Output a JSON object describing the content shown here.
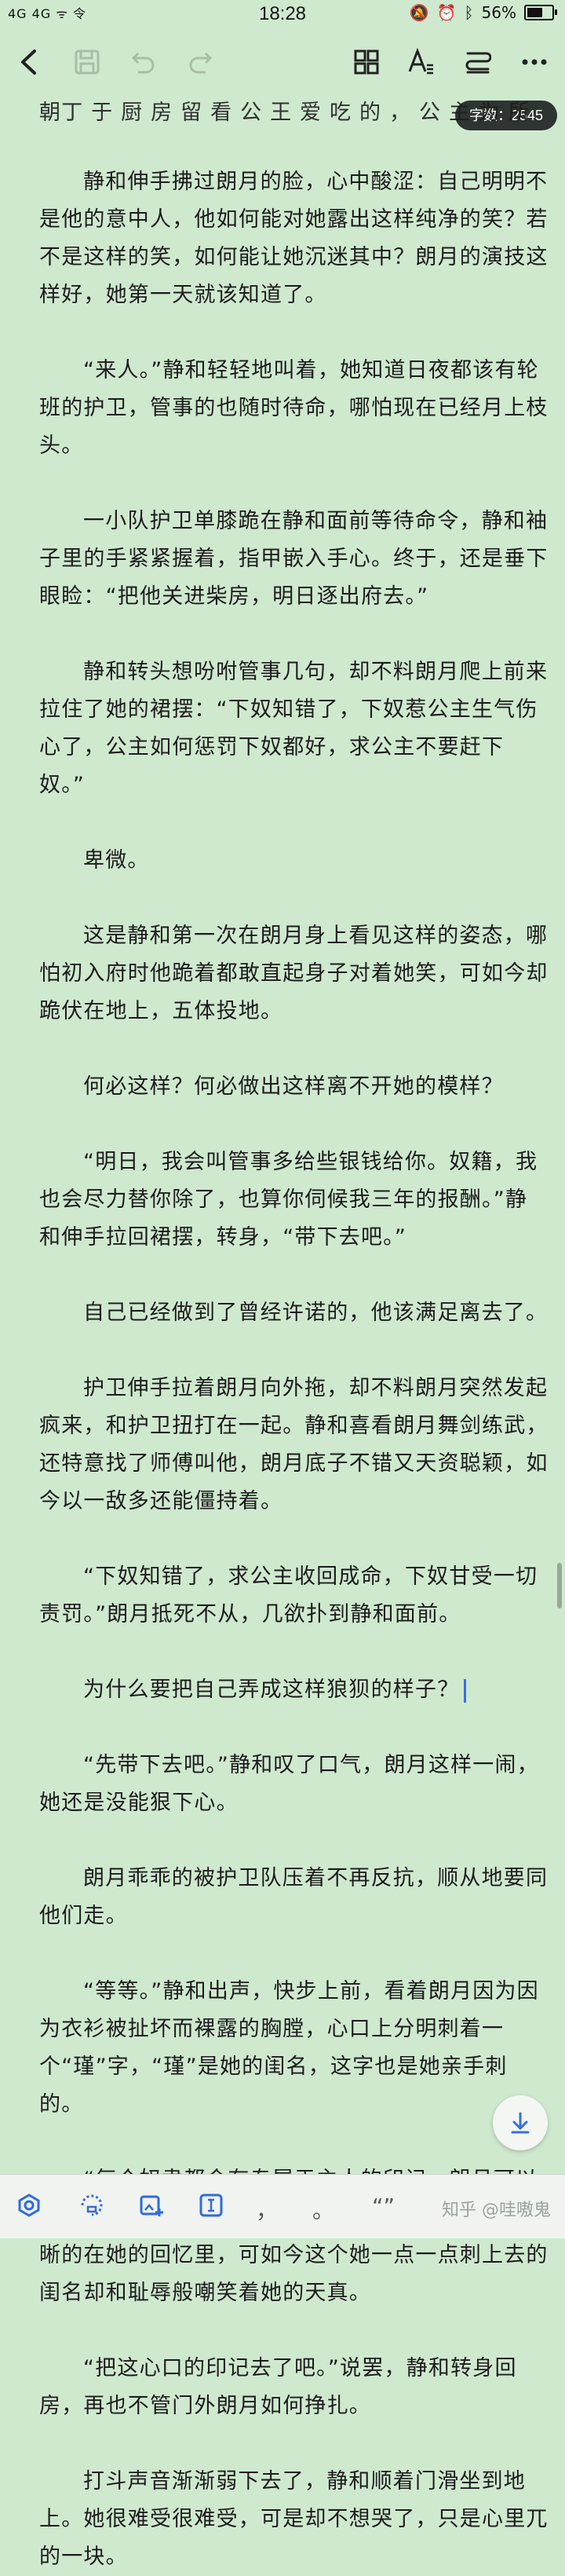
{
  "status": {
    "signal": "4G 4G ᯤ 令",
    "time": "18:28",
    "icons": [
      "bell-icon",
      "alarm-icon",
      "bluetooth-icon",
      "wifi-icon"
    ],
    "battery": "56%"
  },
  "toolbar": {
    "icons": [
      "back-icon",
      "save-icon",
      "undo-icon",
      "redo-icon",
      "layout-icon",
      "font-icon",
      "format-icon",
      "more-icon"
    ],
    "word_count": "字数：2545"
  },
  "paragraphs": [
    "朝丁 于 厨 房 留 看 公 王 爱 吃 的 ， 公 主 为 所 然 的 ？",
    "静和伸手拂过朗月的脸，心中酸涩：自己明明不是他的意中人，他如何能对她露出这样纯净的笑？若不是这样的笑，如何能让她沉迷其中？朗月的演技这样好，她第一天就该知道了。",
    "“来人。”静和轻轻地叫着，她知道日夜都该有轮班的护卫，管事的也随时待命，哪怕现在已经月上枝头。",
    "一小队护卫单膝跪在静和面前等待命令，静和袖子里的手紧紧握着，指甲嵌入手心。终于，还是垂下眼睑：“把他关进柴房，明日逐出府去。”",
    "静和转头想吩咐管事几句，却不料朗月爬上前来拉住了她的裙摆：“下奴知错了，下奴惹公主生气伤心了，公主如何惩罚下奴都好，求公主不要赶下奴。”",
    "卑微。",
    "这是静和第一次在朗月身上看见这样的姿态，哪怕初入府时他跪着都敢直起身子对着她笑，可如今却跪伏在地上，五体投地。",
    "何必这样？何必做出这样离不开她的模样？",
    "“明日，我会叫管事多给些银钱给你。奴籍，我也会尽力替你除了，也算你伺候我三年的报酬。”静和伸手拉回裙摆，转身，“带下去吧。”",
    "自己已经做到了曾经许诺的，他该满足离去了。",
    "护卫伸手拉着朗月向外拖，却不料朗月突然发起疯来，和护卫扭打在一起。静和喜看朗月舞剑练武，还特意找了师傅叫他，朗月底子不错又天资聪颖，如今以一敌多还能僵持着。",
    "“下奴知错了，求公主收回成命，下奴甘受一切责罚。”朗月抵死不从，几欲扑到静和面前。",
    "为什么要把自己弄成这样狼狈的样子？",
    "“先带下去吧。”静和叹了口气，朗月这样一闹，她还是没能狠下心。",
    "朗月乖乖的被护卫队压着不再反抗，顺从地要同他们走。",
    "“等等。”静和出声，快步上前，看着朗月因为因为衣衫被扯坏而裸露的胸膛，心口上分明刺着一个“瑾”字，“瑾”是她的闺名，这字也是她亲手刺的。",
    "“每个奴隶都会有专属于主人的印记，朗月可以斗胆请公主赐一个印记吗？”朗月当初所说的话还清晰的在她的回忆里，可如今这个她一点一点刺上去的闺名却和耻辱般嘲笑着她的天真。",
    "“把这心口的印记去了吧。”说罢，静和转身回房，再也不管门外朗月如何挣扎。",
    "打斗声音渐渐弱下去了，静和顺着门滑坐到地上。她很难受很难受，可是却不想哭了，只是心里兀的一块。"
  ],
  "bottom": {
    "icons": [
      "hexagon-icon",
      "tag-icon",
      "add-image-icon",
      "text-cursor-icon"
    ],
    "punct_comma": "，",
    "punct_period": "。",
    "punct_quote": "“”",
    "watermark": "知乎 @哇嗷鬼"
  }
}
